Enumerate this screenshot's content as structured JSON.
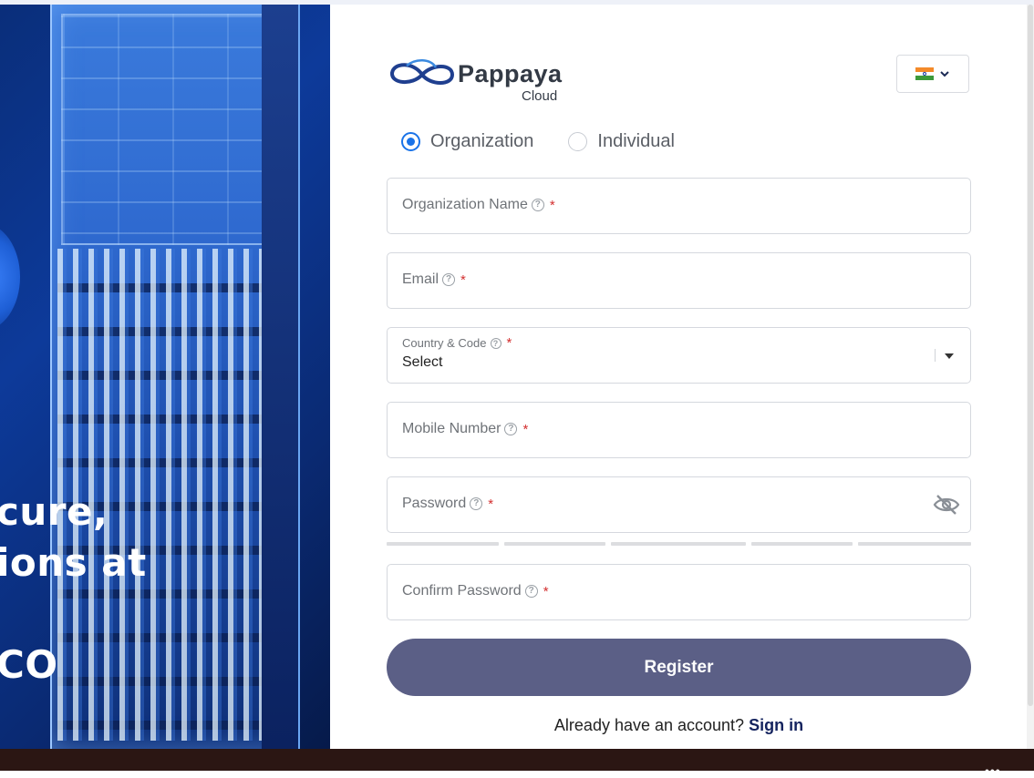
{
  "hero": {
    "line1": "cure,",
    "line2": "ions at",
    "line3": "CO"
  },
  "brand": {
    "name": "Pappaya",
    "sub": "Cloud"
  },
  "language": {
    "flag": "india-flag-icon"
  },
  "account_type": {
    "options": [
      {
        "label": "Organization",
        "checked": true
      },
      {
        "label": "Individual",
        "checked": false
      }
    ]
  },
  "form": {
    "organization_name": {
      "label": "Organization Name",
      "required": "*"
    },
    "email": {
      "label": "Email",
      "required": "*"
    },
    "country": {
      "label": "Country & Code",
      "required": "*",
      "value": "Select"
    },
    "mobile": {
      "label": "Mobile Number",
      "required": "*"
    },
    "password": {
      "label": "Password",
      "required": "*"
    },
    "confirm_password": {
      "label": "Confirm Password",
      "required": "*"
    },
    "help_glyph": "?"
  },
  "register_label": "Register",
  "signin": {
    "prompt": "Already have an account?",
    "link": "Sign in"
  },
  "colors": {
    "accent": "#1a73e8",
    "button": "#5b5f86",
    "link": "#14235e",
    "required": "#d32f2f"
  }
}
